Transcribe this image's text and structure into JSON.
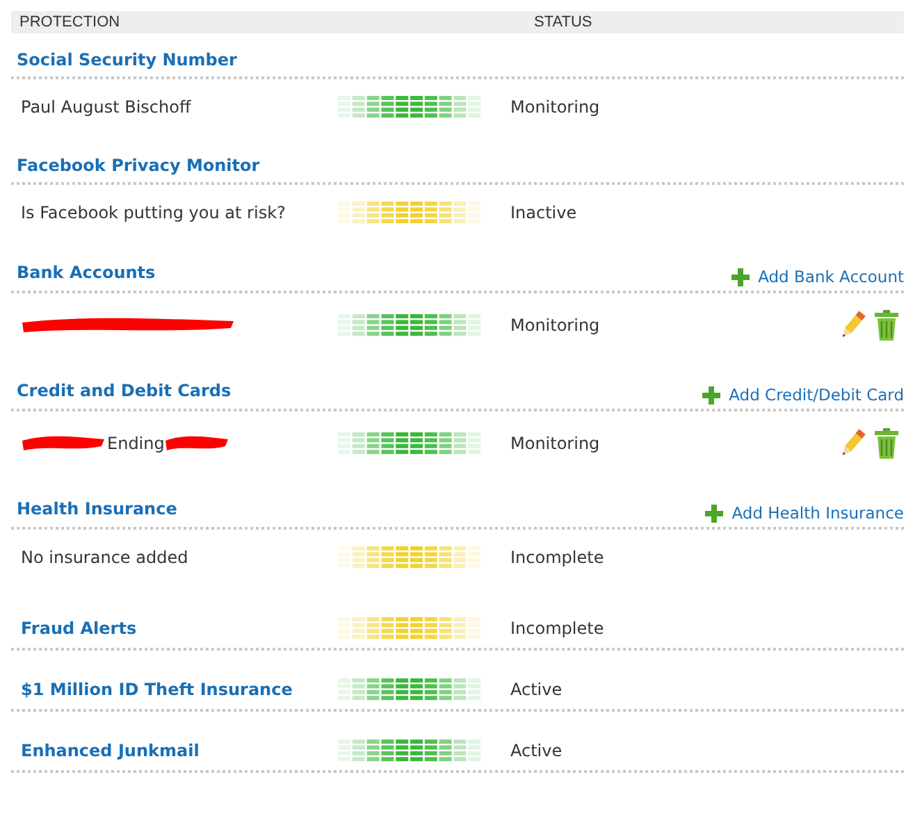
{
  "header": {
    "columns": [
      "PROTECTION",
      "STATUS"
    ]
  },
  "sections": [
    {
      "title": "Social Security Number",
      "rows": [
        {
          "kind": "text",
          "label": "Paul August Bischoff",
          "color": "#3cb83c",
          "status": "Monitoring",
          "editable": false
        }
      ]
    },
    {
      "title": "Facebook Privacy Monitor",
      "rows": [
        {
          "kind": "text",
          "label": "Is Facebook putting you at risk?",
          "color": "#f2d22e",
          "status": "Inactive",
          "editable": false
        }
      ]
    },
    {
      "title": "Bank Accounts",
      "action": "Add Bank Account",
      "rows": [
        {
          "kind": "redacted",
          "color": "#3cb83c",
          "status": "Monitoring",
          "editable": true
        }
      ]
    },
    {
      "title": "Credit and Debit Cards",
      "action": "Add Credit/Debit Card",
      "rows": [
        {
          "kind": "redacted",
          "label": "Ending",
          "color": "#3cb83c",
          "status": "Monitoring",
          "editable": true
        }
      ]
    },
    {
      "title": "Health Insurance",
      "action": "Add Health Insurance",
      "rows": [
        {
          "kind": "text",
          "label": "No insurance added",
          "color": "#f2d22e",
          "status": "Incomplete",
          "editable": false
        }
      ]
    },
    {
      "title": "Fraud Alerts",
      "color": "#f2d22e",
      "status": "Incomplete"
    },
    {
      "title": "$1 Million ID Theft Insurance",
      "color": "#3cb83c",
      "status": "Active"
    },
    {
      "title": "Enhanced Junkmail",
      "color": "#3cb83c",
      "status": "Active"
    }
  ]
}
